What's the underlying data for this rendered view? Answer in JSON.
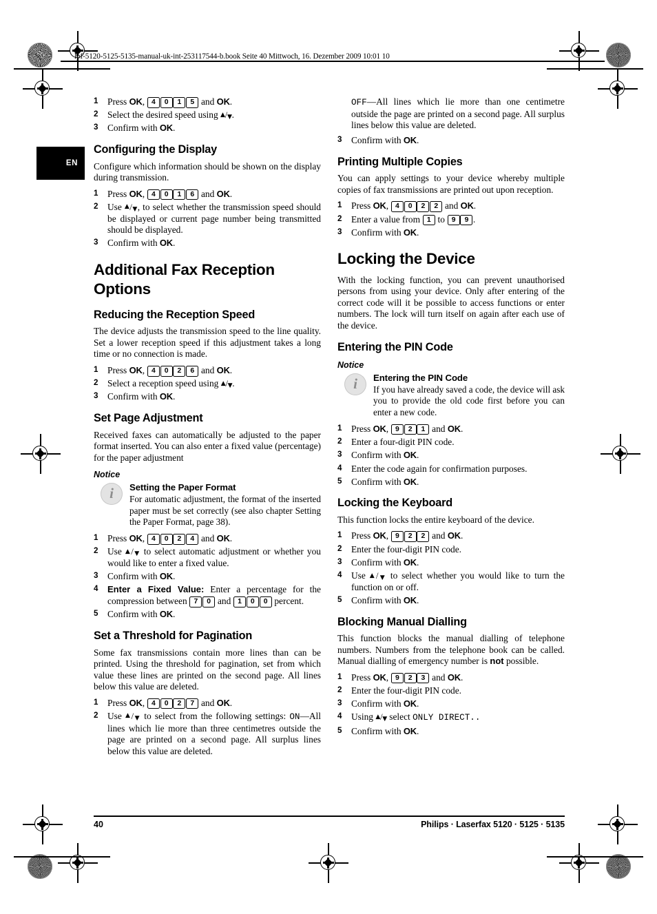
{
  "page": {
    "file_header": "lpf-5120-5125-5135-manual-uk-int-253117544-b.book  Seite 40  Mittwoch, 16. Dezember 2009  10:01 10",
    "language_tab": "EN",
    "footer_page_number": "40",
    "footer_brand": "Philips · Laserfax 5120 · 5125 · 5135"
  },
  "left_column": {
    "top_steps": [
      {
        "num": "1",
        "parts": [
          "Press ",
          "OK",
          ", ",
          "4",
          "0",
          "1",
          "5",
          " and ",
          "OK",
          "."
        ]
      },
      {
        "num": "2",
        "text_before": "Select the desired speed using ",
        "text_after": "."
      },
      {
        "num": "3",
        "text_before": "Confirm with ",
        "ok": "OK",
        "text_after": "."
      }
    ],
    "configuring_display": {
      "heading": "Configuring the Display",
      "intro": "Configure which information should be shown on the display during transmission.",
      "steps": [
        {
          "num": "1",
          "keys": [
            "4",
            "0",
            "1",
            "6"
          ]
        },
        {
          "num": "2",
          "text": "Use  , to select whether the transmission speed should be displayed or current page number being transmitted should be displayed."
        },
        {
          "num": "3",
          "text": "Confirm with OK."
        }
      ]
    },
    "additional_fax": {
      "heading": "Additional Fax Reception Options"
    },
    "reducing_speed": {
      "heading": "Reducing the Reception Speed",
      "intro": "The device adjusts the transmission speed to the line quality. Set a lower reception speed if this adjustment takes a long time or no connection is made.",
      "steps": [
        {
          "num": "1",
          "keys": [
            "4",
            "0",
            "2",
            "6"
          ]
        },
        {
          "num": "2",
          "text": "Select a reception speed using  ."
        },
        {
          "num": "3",
          "text": "Confirm with OK."
        }
      ]
    },
    "page_adjustment": {
      "heading": "Set Page Adjustment",
      "intro": "Received faxes can automatically be adjusted to the paper format inserted. You can also enter a fixed value (percentage) for the paper adjustment",
      "notice_label": "Notice",
      "notice_title": "Setting the Paper Format",
      "notice_text": "For automatic adjustment, the format of the inserted paper must be set correctly (see also chapter Setting the Paper Format, page 38).",
      "steps": [
        {
          "num": "1",
          "keys": [
            "4",
            "0",
            "2",
            "4"
          ]
        },
        {
          "num": "2",
          "text": "Use   to select automatic adjustment or whether you would like to enter a fixed value."
        },
        {
          "num": "3",
          "text": "Confirm with OK."
        },
        {
          "num": "4",
          "lead": "Enter a Fixed Value:",
          "text": "Enter a percentage for the compression between",
          "keys_from": [
            "7",
            "0"
          ],
          "mid": "and",
          "keys_to": [
            "1",
            "0",
            "0"
          ],
          "tail": "percent."
        },
        {
          "num": "5",
          "text": "Confirm with OK."
        }
      ]
    },
    "threshold": {
      "heading": "Set a Threshold for Pagination",
      "intro": "Some fax transmissions contain more lines than can be printed. Using the threshold for pagination, set from which value these lines are printed on the second page. All lines below this value are deleted.",
      "steps": [
        {
          "num": "1",
          "keys": [
            "4",
            "0",
            "2",
            "7"
          ]
        },
        {
          "num": "2",
          "text": "Use   to select from the following settings:"
        }
      ],
      "on_label": "ON",
      "on_text": "—All lines which lie more than three centimetres outside the page are printed on a second page. All surplus lines below this value are deleted."
    }
  },
  "right_column": {
    "off_label": "OFF",
    "off_text": "—All lines which lie more than one centimetre outside the page are printed on a second page. All surplus lines below this value are deleted.",
    "off_confirm": {
      "num": "3",
      "text": "Confirm with OK."
    },
    "multiple_copies": {
      "heading": "Printing Multiple Copies",
      "intro": "You can apply settings to your device whereby multiple copies of fax transmissions are printed out upon reception.",
      "steps": [
        {
          "num": "1",
          "keys": [
            "4",
            "0",
            "2",
            "2"
          ]
        },
        {
          "num": "2",
          "text_before": "Enter a value from",
          "key_from": [
            "1"
          ],
          "mid": "to",
          "key_to": [
            "9",
            "9"
          ],
          "tail": "."
        },
        {
          "num": "3",
          "text": "Confirm with OK."
        }
      ]
    },
    "locking_device": {
      "heading": "Locking the Device",
      "intro": "With the locking function, you can prevent unauthorised persons from using your device. Only after entering of the correct code will it be possible to access functions or enter numbers. The lock will turn itself on again after each use of the device."
    },
    "pin_code": {
      "heading": "Entering the PIN Code",
      "notice_label": "Notice",
      "notice_title": "Entering the PIN Code",
      "notice_text": "If you have already saved a code, the device will ask you to provide the old code first before you can enter a new code.",
      "steps": [
        {
          "num": "1",
          "keys": [
            "9",
            "2",
            "1"
          ]
        },
        {
          "num": "2",
          "text": "Enter a four-digit PIN code."
        },
        {
          "num": "3",
          "text": "Confirm with OK."
        },
        {
          "num": "4",
          "text": "Enter the code again for confirmation purposes."
        },
        {
          "num": "5",
          "text": "Confirm with OK."
        }
      ]
    },
    "locking_keyboard": {
      "heading": "Locking the Keyboard",
      "intro": "This function locks the entire keyboard of the device.",
      "steps": [
        {
          "num": "1",
          "keys": [
            "9",
            "2",
            "2"
          ]
        },
        {
          "num": "2",
          "text": "Enter the four-digit PIN code."
        },
        {
          "num": "3",
          "text": "Confirm with OK."
        },
        {
          "num": "4",
          "text": "Use   to select whether you would like to turn the function on or off."
        },
        {
          "num": "5",
          "text": "Confirm with OK."
        }
      ]
    },
    "blocking_dialling": {
      "heading": "Blocking Manual Dialling",
      "intro_1": "This function blocks the manual dialling of telephone numbers. Numbers from the telephone book can be called. Manual dialling of emergency number is ",
      "intro_bold": "not",
      "intro_2": " possible.",
      "steps": [
        {
          "num": "1",
          "keys": [
            "9",
            "2",
            "3"
          ]
        },
        {
          "num": "2",
          "text": "Enter the four-digit PIN code."
        },
        {
          "num": "3",
          "text": "Confirm with OK."
        },
        {
          "num": "4",
          "text": "Using   select"
        },
        {
          "num": "5",
          "text": "Confirm with OK."
        }
      ],
      "only_direct": "ONLY DIRECT.."
    }
  },
  "labels": {
    "press": "Press",
    "ok": "OK",
    "and": "and",
    "confirm_with": "Confirm with",
    "period": ".",
    "comma": ",",
    "select_desired_speed": "Select the desired speed using",
    "use": "Use",
    "to_select_transmission": ", to select whether the transmission speed should be displayed or current page number being transmitted should be displayed.",
    "select_reception_speed": "Select a reception speed using",
    "use_auto_adjust": "to select automatic adjustment or whether you would like to enter a fixed value.",
    "enter_fixed_value_lead": "Enter a Fixed Value:",
    "enter_percentage": "Enter a percentage for the compression between",
    "percent": "percent.",
    "use_select_settings": "to select from the following settings:",
    "enter_value_from": "Enter a value from",
    "to": "to",
    "enter_four_digit_pin": "Enter a four-digit PIN code.",
    "enter_the_four_digit_pin": "Enter the four-digit PIN code.",
    "enter_code_again": "Enter the code again for confirmation purposes.",
    "use_turn_on_off": "to select whether you would like to turn the function on or off.",
    "using": "Using",
    "select": "select",
    "i_icon": "i"
  }
}
